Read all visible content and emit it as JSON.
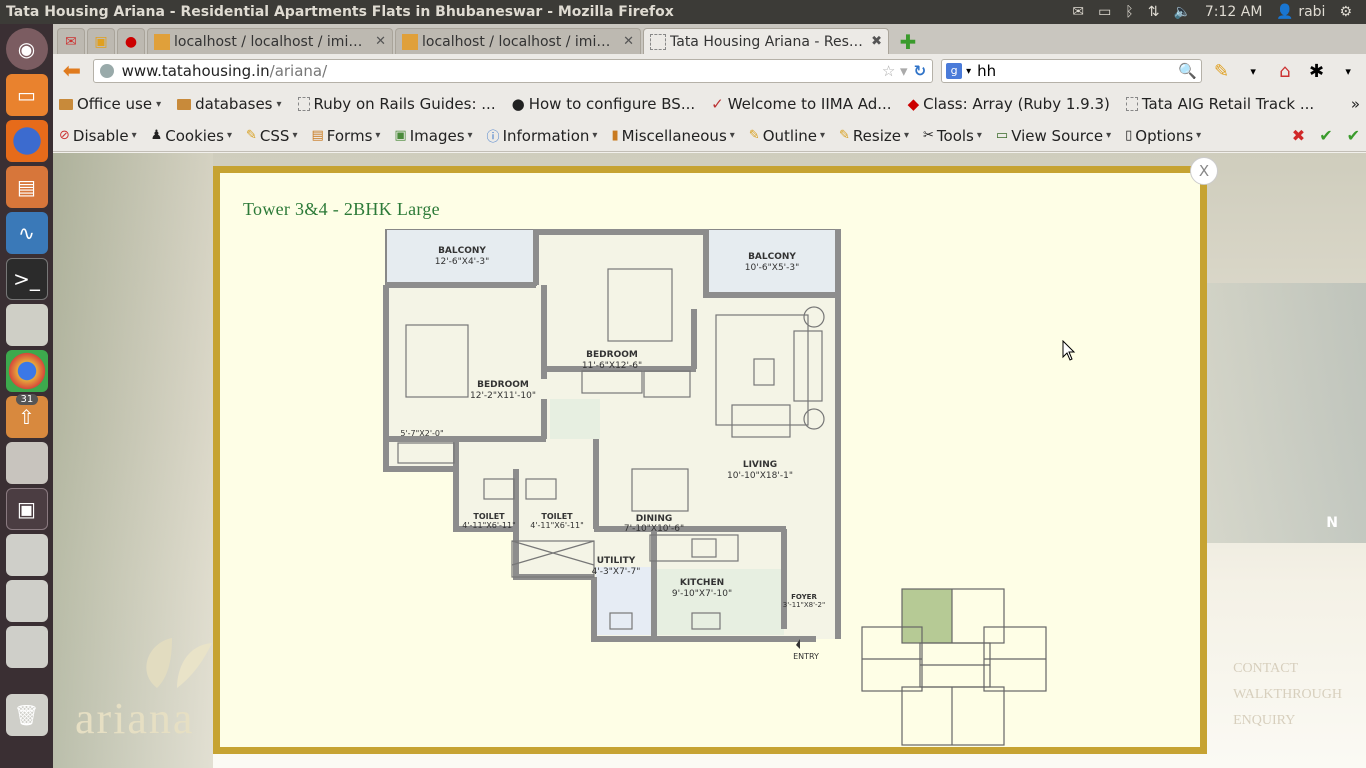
{
  "system": {
    "window_title": "Tata Housing Ariana - Residential Apartments Flats in Bhubaneswar - Mozilla Firefox",
    "time": "7:12 AM",
    "user": "rabi"
  },
  "launcher": {
    "items": [
      {
        "name": "dash-home-icon"
      },
      {
        "name": "files-icon"
      },
      {
        "name": "firefox-icon"
      },
      {
        "name": "libreoffice-impress-icon"
      },
      {
        "name": "system-monitor-icon"
      },
      {
        "name": "terminal-icon"
      },
      {
        "name": "drive-icon"
      },
      {
        "name": "chrome-icon"
      },
      {
        "name": "update-manager-icon",
        "badge": "31"
      },
      {
        "name": "mysql-workbench-icon"
      },
      {
        "name": "workspace-switcher-icon"
      },
      {
        "name": "disk-icon-1"
      },
      {
        "name": "disk-icon-2"
      },
      {
        "name": "disk-icon-3"
      },
      {
        "name": "trash-icon"
      }
    ]
  },
  "tabs": [
    {
      "label": "localhost / localhost / imi_t...",
      "active": false
    },
    {
      "label": "localhost / localhost / imi_t...",
      "active": false
    },
    {
      "label": "Tata Housing Ariana - Resid...",
      "active": true
    }
  ],
  "navbar": {
    "url_host": "www.tatahousing.in",
    "url_path": "/ariana/",
    "search_value": "hh"
  },
  "bookmarks": [
    {
      "label": "Office use",
      "type": "folder"
    },
    {
      "label": "databases",
      "type": "folder"
    },
    {
      "label": "Ruby on Rails Guides: ...",
      "type": "page"
    },
    {
      "label": "How to configure BS...",
      "type": "page"
    },
    {
      "label": "Welcome to IIMA Ad...",
      "type": "page"
    },
    {
      "label": "Class: Array (Ruby 1.9.3)",
      "type": "page"
    },
    {
      "label": "Tata AIG Retail Track ...",
      "type": "page"
    }
  ],
  "devtools": [
    {
      "label": "Disable",
      "icon": "⊘"
    },
    {
      "label": "Cookies",
      "icon": "♟"
    },
    {
      "label": "CSS",
      "icon": "✎"
    },
    {
      "label": "Forms",
      "icon": "▤"
    },
    {
      "label": "Images",
      "icon": "▣"
    },
    {
      "label": "Information",
      "icon": "ⓘ"
    },
    {
      "label": "Miscellaneous",
      "icon": "▮"
    },
    {
      "label": "Outline",
      "icon": "✎"
    },
    {
      "label": "Resize",
      "icon": "✎"
    },
    {
      "label": "Tools",
      "icon": "✂"
    },
    {
      "label": "View Source",
      "icon": "▭"
    },
    {
      "label": "Options",
      "icon": "▯"
    }
  ],
  "modal": {
    "title": "Tower 3&4 - 2BHK Large",
    "close_label": "X"
  },
  "floorplan": {
    "rooms": [
      {
        "name": "BALCONY",
        "size": "12'-6\"X4'-3\""
      },
      {
        "name": "BALCONY",
        "size": "10'-6\"X5'-3\""
      },
      {
        "name": "BEDROOM",
        "size": "11'-6\"X12'-6\""
      },
      {
        "name": "BEDROOM",
        "size": "12'-2\"X11'-10\""
      },
      {
        "name": "LIVING",
        "size": "10'-10\"X18'-1\""
      },
      {
        "name": "DINING",
        "size": "7'-10\"X10'-6\""
      },
      {
        "name": "TOILET",
        "size": "4'-11\"X6'-11\""
      },
      {
        "name": "TOILET",
        "size": "4'-11\"X6'-11\""
      },
      {
        "name": "UTILITY",
        "size": "4'-3\"X7'-7\""
      },
      {
        "name": "KITCHEN",
        "size": "9'-10\"X7'-10\""
      },
      {
        "name": "FOYER",
        "size": "3'-11\"X8'-2\""
      }
    ],
    "wardrobe_label": "5'-7\"X2'-0\"",
    "entry_label": "ENTRY"
  },
  "background": {
    "side_links": [
      "CONTACT",
      "WALKTHROUGH",
      "ENQUIRY"
    ],
    "logo_text": "ariana",
    "compass_label": "N"
  },
  "colors": {
    "modal_border": "#c6a332",
    "modal_bg": "#fefee6",
    "title_green": "#2c7a38",
    "launcher_bg": "#3a2f33"
  }
}
